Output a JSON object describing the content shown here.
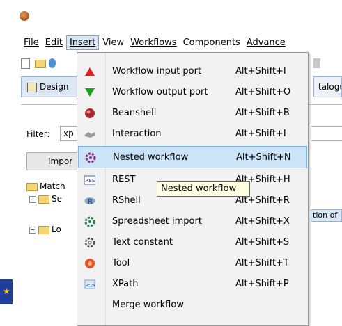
{
  "menubar": {
    "items": [
      "File",
      "Edit",
      "Insert",
      "View",
      "Workflows",
      "Components",
      "Advance"
    ]
  },
  "tabs": {
    "design": "Design",
    "catalogue": "talogu"
  },
  "filter": {
    "label": "Filter:",
    "value": "xp"
  },
  "import_button": "Impor",
  "tree": {
    "items": [
      "Match",
      "Se",
      "Lo"
    ]
  },
  "partial_label": "tion of",
  "insert_menu": {
    "items": [
      {
        "label": "Workflow input port",
        "shortcut": "Alt+Shift+I",
        "icon": "red-up-triangle-icon"
      },
      {
        "label": "Workflow output port",
        "shortcut": "Alt+Shift+O",
        "icon": "green-down-triangle-icon"
      },
      {
        "label": "Beanshell",
        "shortcut": "Alt+Shift+B",
        "icon": "beanshell-icon"
      },
      {
        "label": "Interaction",
        "shortcut": "Alt+Shift+I",
        "icon": "handshake-icon"
      },
      {
        "label": "Nested workflow",
        "shortcut": "Alt+Shift+N",
        "icon": "nested-workflow-gear-icon"
      },
      {
        "label": "REST",
        "shortcut": "Alt+Shift+H",
        "icon": "rest-icon"
      },
      {
        "label": "RShell",
        "shortcut": "Alt+Shift+R",
        "icon": "r-logo-icon"
      },
      {
        "label": "Spreadsheet import",
        "shortcut": "Alt+Shift+X",
        "icon": "green-gear-icon"
      },
      {
        "label": "Text constant",
        "shortcut": "Alt+Shift+S",
        "icon": "gear-outline-icon"
      },
      {
        "label": "Tool",
        "shortcut": "Alt+Shift+T",
        "icon": "tool-icon"
      },
      {
        "label": "XPath",
        "shortcut": "Alt+Shift+P",
        "icon": "xpath-icon"
      },
      {
        "label": "Merge workflow",
        "shortcut": "",
        "icon": ""
      }
    ]
  },
  "tooltip": "Nested workflow"
}
